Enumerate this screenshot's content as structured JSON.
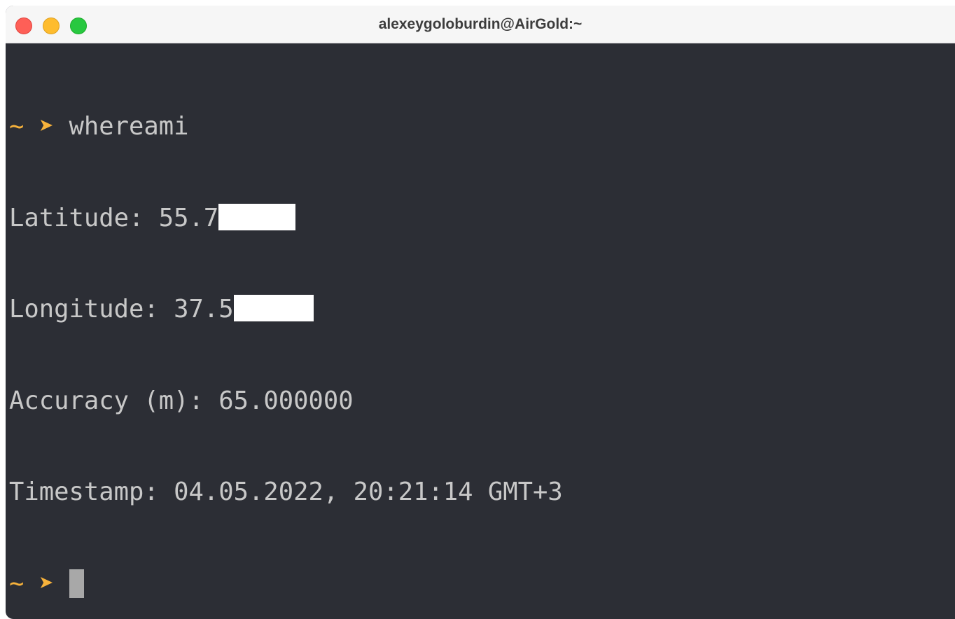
{
  "window": {
    "title": "alexeygoloburdin@AirGold:~"
  },
  "terminal": {
    "prompt_symbol": "~ ➤ ",
    "command": "whereami",
    "latitude_label": "Latitude: ",
    "latitude_value_visible": "55.7",
    "longitude_label": "Longitude: ",
    "longitude_value_visible": "37.5",
    "accuracy_line": "Accuracy (m): 65.000000",
    "timestamp_line": "Timestamp: 04.05.2022, 20:21:14 GMT+3",
    "second_prompt_symbol": "~ ➤ "
  },
  "colors": {
    "terminal_background": "#2c2e35",
    "terminal_text": "#c8c8c8",
    "prompt_accent": "#f7b23b",
    "titlebar_background": "#f6f6f6",
    "close_button": "#fe5f57",
    "minimize_button": "#febc2e",
    "maximize_button": "#28c840"
  }
}
